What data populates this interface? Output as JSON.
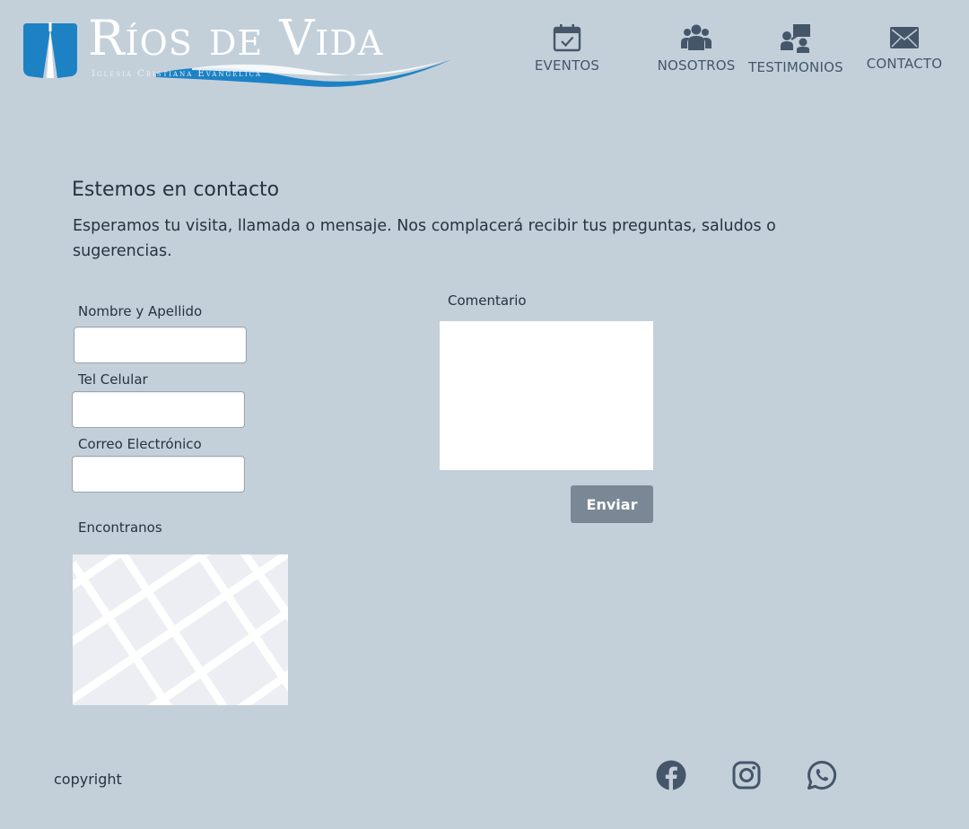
{
  "header": {
    "logo": {
      "title": "Ríos de Vida",
      "subtitle": "Iglesia Cristiana Evangélica"
    },
    "nav": [
      {
        "label": "EVENTOS",
        "icon": "calendar-check-icon"
      },
      {
        "label": "NOSOTROS",
        "icon": "group-icon"
      },
      {
        "label": "TESTIMONIOS",
        "icon": "speaker-presentation-icon"
      },
      {
        "label": "CONTACTO",
        "icon": "envelope-icon"
      }
    ]
  },
  "main": {
    "title": "Estemos en contacto",
    "intro": "Esperamos tu visita, llamada o mensaje. Nos complacerá recibir tus preguntas, saludos o sugerencias.",
    "form": {
      "name_label": "Nombre y Apellido",
      "name_value": "",
      "phone_label": "Tel Celular",
      "phone_value": "",
      "email_label": "Correo Electrónico",
      "email_value": "",
      "comment_label": "Comentario",
      "comment_value": "",
      "submit_label": "Enviar"
    },
    "map_label": "Encontranos"
  },
  "footer": {
    "copyright": "copyright",
    "social": [
      {
        "icon": "facebook-icon"
      },
      {
        "icon": "instagram-icon"
      },
      {
        "icon": "whatsapp-icon"
      }
    ]
  },
  "colors": {
    "background": "#c3d0da",
    "text": "#27333f",
    "nav_icon": "#46566a",
    "logo_blue": "#1d82c4",
    "button": "#7a8896",
    "map_bg": "#eceef3"
  }
}
